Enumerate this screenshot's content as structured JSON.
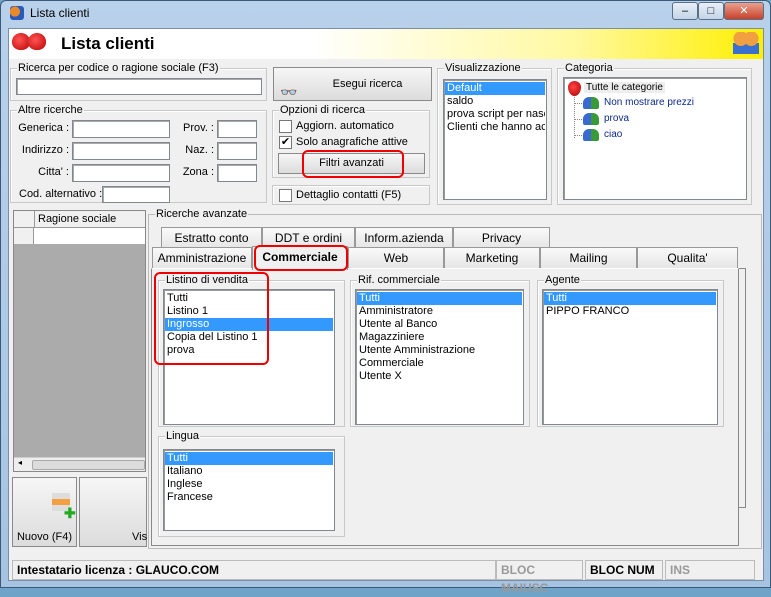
{
  "window": {
    "title": "Lista clienti",
    "min": "–",
    "max": "□",
    "close": "✕"
  },
  "header": {
    "title": "Lista clienti"
  },
  "search": {
    "group": "Ricerca per codice o ragione sociale (F3)",
    "value": "",
    "button": "Esegui ricerca"
  },
  "other": {
    "group": "Altre ricerche",
    "generica": "Generica :",
    "indirizzo": "Indirizzo :",
    "citta": "Citta' :",
    "cod": "Cod. alternativo :",
    "prov": "Prov. :",
    "naz": "Naz. :",
    "zona": "Zona :"
  },
  "options": {
    "group": "Opzioni di ricerca",
    "auto": "Aggiorn. automatico",
    "auto_checked": false,
    "active": "Solo anagrafiche attive",
    "active_checked": true,
    "filters": "Filtri avanzati",
    "contacts": "Dettaglio contatti (F5)",
    "contacts_checked": false
  },
  "view": {
    "group": "Visualizzazione",
    "items": [
      "Default",
      "saldo",
      "prova script per nasc",
      "Clienti che hanno acc"
    ],
    "selected": 0
  },
  "category": {
    "group": "Categoria",
    "root": "Tutte le categorie",
    "items": [
      "Non mostrare prezzi",
      "prova",
      "ciao"
    ]
  },
  "grid": {
    "column": "Ragione sociale"
  },
  "buttons": {
    "new": "Nuovo (F4)",
    "view": "Vis"
  },
  "advanced": {
    "group": "Ricerche avanzate",
    "tabs_row1": [
      "Estratto conto",
      "DDT e ordini",
      "Inform.azienda",
      "Privacy"
    ],
    "tabs_row2": [
      "Amministrazione",
      "Commerciale",
      "Web",
      "Marketing",
      "Mailing",
      "Qualita'"
    ],
    "active_tab": "Commerciale",
    "listino": {
      "label": "Listino di vendita",
      "items": [
        "Tutti",
        "Listino 1",
        "Ingrosso",
        "Copia del Listino 1",
        "prova"
      ],
      "selected": 2
    },
    "rif": {
      "label": "Rif. commerciale",
      "items": [
        "Tutti",
        "Amministratore",
        "Utente al Banco",
        "Magazziniere",
        "Utente Amministrazione",
        "Commerciale",
        "Utente X"
      ],
      "selected": 0
    },
    "agente": {
      "label": "Agente",
      "items": [
        "Tutti",
        "PIPPO FRANCO"
      ],
      "selected": 0
    },
    "lingua": {
      "label": "Lingua",
      "items": [
        "Tutti",
        "Italiano",
        "Inglese",
        "Francese"
      ],
      "selected": 0
    }
  },
  "status": {
    "license": "Intestatario licenza : GLAUCO.COM",
    "caps": "BLOC MAIUSC",
    "num": "BLOC NUM",
    "ins": "INS"
  }
}
